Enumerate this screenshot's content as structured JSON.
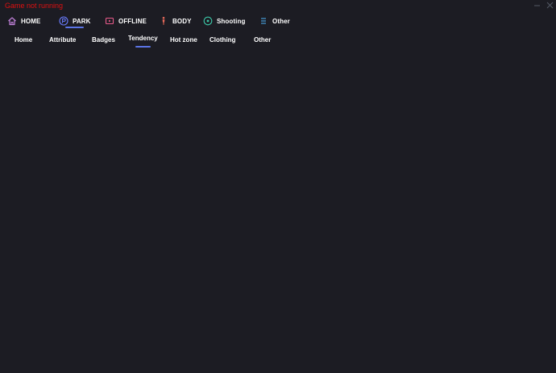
{
  "status": {
    "text": "Game not running",
    "color": "#e01010"
  },
  "window_controls": {
    "minimize_icon": "minimize-icon",
    "close_icon": "close-icon"
  },
  "main_nav": {
    "items": [
      {
        "label": "HOME",
        "icon": "home-icon",
        "icon_color": "#c080d8"
      },
      {
        "label": "PARK",
        "icon": "parking-icon",
        "icon_color": "#6a7cff",
        "active": true
      },
      {
        "label": "OFFLINE",
        "icon": "tv-icon",
        "icon_color": "#e85a8a"
      },
      {
        "label": "BODY",
        "icon": "person-icon",
        "icon_color": "#e86a5a"
      },
      {
        "label": "Shooting",
        "icon": "target-icon",
        "icon_color": "#3cc8a8"
      },
      {
        "label": "Other",
        "icon": "list-icon",
        "icon_color": "#4aa8e8"
      }
    ],
    "active_color": "#5b74e6"
  },
  "sub_nav": {
    "items": [
      {
        "label": "Home"
      },
      {
        "label": "Attribute"
      },
      {
        "label": "Badges"
      },
      {
        "label": "Tendency",
        "active": true
      },
      {
        "label": "Hot zone"
      },
      {
        "label": "Clothing"
      },
      {
        "label": "Other"
      }
    ]
  }
}
